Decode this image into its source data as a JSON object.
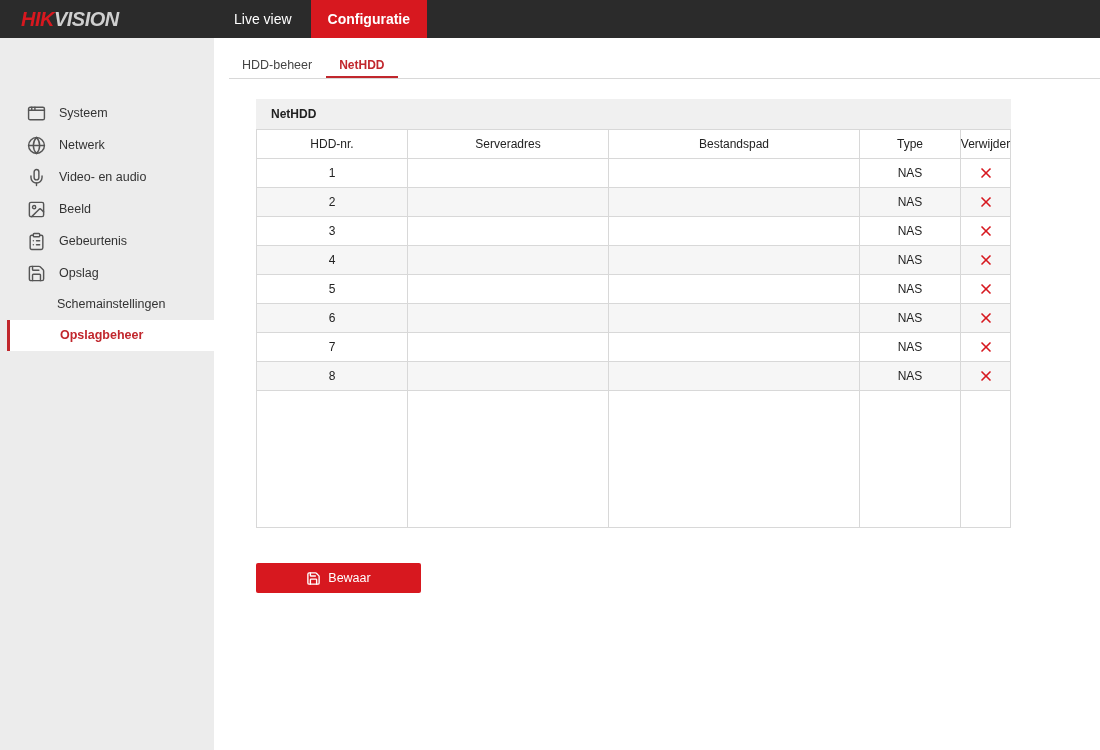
{
  "logo": {
    "accent": "HIK",
    "rest": "VISION"
  },
  "nav": [
    {
      "label": "Live view",
      "selected": false
    },
    {
      "label": "Configuratie",
      "selected": true
    }
  ],
  "sidebar": {
    "items": [
      {
        "kind": "category",
        "label": "Systeem"
      },
      {
        "kind": "category",
        "label": "Netwerk"
      },
      {
        "kind": "category",
        "label": "Video- en audio"
      },
      {
        "kind": "category",
        "label": "Beeld"
      },
      {
        "kind": "category",
        "label": "Gebeurtenis"
      },
      {
        "kind": "category",
        "label": "Opslag"
      },
      {
        "kind": "sub",
        "label": "Schemainstellingen",
        "selected": false
      },
      {
        "kind": "sub",
        "label": "Opslagbeheer",
        "selected": true
      }
    ]
  },
  "tabs": [
    {
      "label": "HDD-beheer",
      "selected": false
    },
    {
      "label": "NetHDD",
      "selected": true
    }
  ],
  "section": {
    "title": "NetHDD"
  },
  "table": {
    "columns": [
      "HDD-nr.",
      "Serveradres",
      "Bestandspad",
      "Type",
      "Verwijder"
    ],
    "rows": [
      {
        "number": "1",
        "type": "NAS"
      },
      {
        "number": "2",
        "type": "NAS"
      },
      {
        "number": "3",
        "type": "NAS"
      },
      {
        "number": "4",
        "type": "NAS"
      },
      {
        "number": "5",
        "type": "NAS"
      },
      {
        "number": "6",
        "type": "NAS"
      },
      {
        "number": "7",
        "type": "NAS"
      },
      {
        "number": "8",
        "type": "NAS"
      }
    ]
  },
  "save_button": {
    "label": "Bewaar"
  }
}
